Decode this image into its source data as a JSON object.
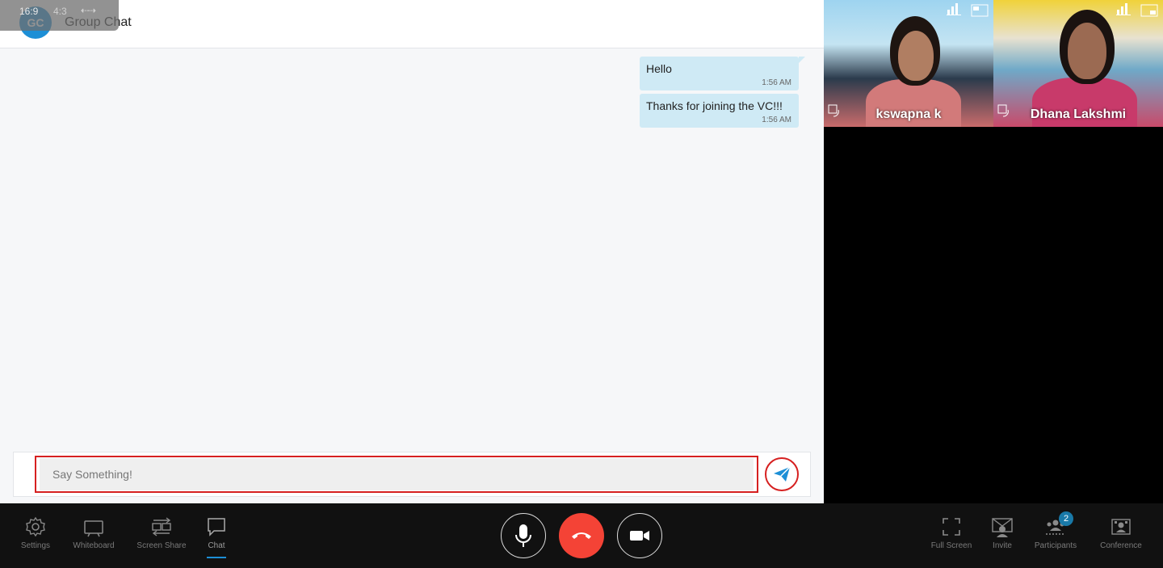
{
  "header": {
    "avatar_initials": "GC",
    "title": "Group Chat"
  },
  "aspect_overlay": {
    "ratio_169": "16:9",
    "ratio_43": "4:3",
    "arrows": "⇠⇢"
  },
  "messages": [
    {
      "text": "Hello",
      "time": "1:56 AM"
    },
    {
      "text": "Thanks for joining the VC!!!",
      "time": "1:56 AM"
    }
  ],
  "composer": {
    "placeholder": "Say Something!"
  },
  "participants": [
    {
      "name": "kswapna k"
    },
    {
      "name": "Dhana Lakshmi"
    }
  ],
  "toolbar": {
    "left": [
      {
        "label": "Settings",
        "icon": "gear-icon"
      },
      {
        "label": "Whiteboard",
        "icon": "whiteboard-icon"
      },
      {
        "label": "Screen Share",
        "icon": "screen-share-icon"
      },
      {
        "label": "Chat",
        "icon": "chat-icon"
      }
    ],
    "right": [
      {
        "label": "Full Screen",
        "icon": "fullscreen-icon"
      },
      {
        "label": "Invite",
        "icon": "invite-icon"
      },
      {
        "label": "Participants",
        "icon": "participants-icon"
      },
      {
        "label": "Conference",
        "icon": "conference-icon"
      }
    ],
    "participants_count": "2"
  },
  "colors": {
    "accent": "#1d8fd6",
    "end_call": "#f44336",
    "highlight": "#d62020",
    "bubble": "#cfeaf5"
  }
}
